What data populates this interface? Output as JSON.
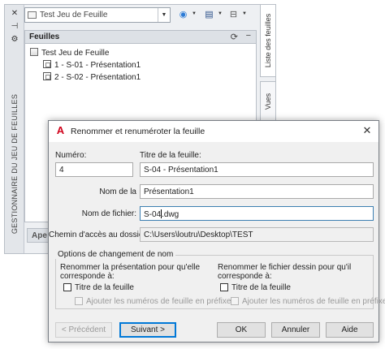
{
  "palette": {
    "vertical_title": "GESTIONNAIRE DU JEU DE FEUILLES",
    "sheetset_select": "Test Jeu de Feuille",
    "sheets_header": "Feuilles",
    "tree": {
      "root": "Test Jeu de Feuille",
      "items": [
        "1 - S-01 - Présentation1",
        "2 - S-02 - Présentation1"
      ]
    },
    "side_tabs": [
      "Liste des feuilles",
      "Vues"
    ],
    "preview_tab": "Ape"
  },
  "dialog": {
    "title": "Renommer et renuméroter la feuille",
    "numero_label": "Numéro:",
    "numero_value": "4",
    "sheet_title_label": "Titre de la feuille:",
    "sheet_title_value": "S-04 - Présentation1",
    "layout_name_label": "Nom de la",
    "layout_name_value": "Présentation1",
    "file_name_label": "Nom de fichier:",
    "file_name_before_caret": "S-04",
    "file_name_after_caret": ".dwg",
    "path_label": "Chemin d'accès au dossier:",
    "path_value": "C:\\Users\\loutru\\Desktop\\TEST",
    "options": {
      "legend": "Options de changement de nom",
      "left_heading_line1": "Renommer la présentation pour qu'elle",
      "left_heading_line2": "corresponde à:",
      "left_check_label": "Titre de la feuille",
      "left_prefix_label": "Ajouter les numéros de feuille en préfixe",
      "right_heading_line1": "Renommer le fichier dessin pour qu'il",
      "right_heading_line2": "corresponde à:",
      "right_check_label": "Titre de la feuille",
      "right_prefix_label": "Ajouter les numéros de feuille en préfixe"
    },
    "buttons": {
      "previous": "< Précédent",
      "next": "Suivant >",
      "ok": "OK",
      "cancel": "Annuler",
      "help": "Aide"
    }
  }
}
